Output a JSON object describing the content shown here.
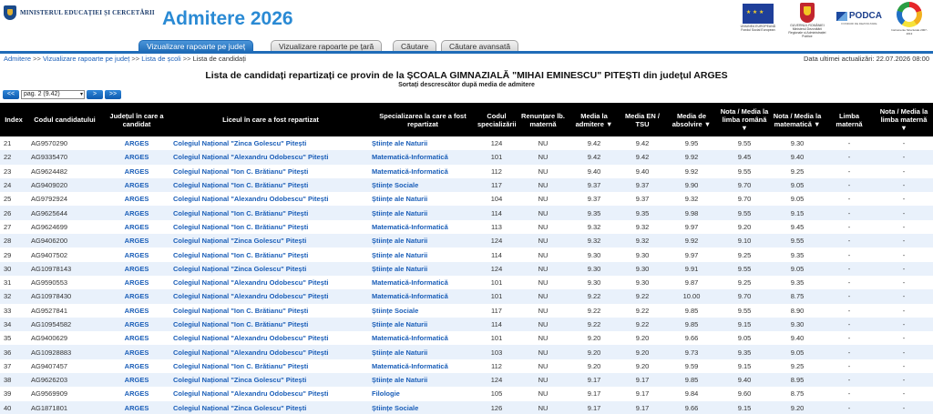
{
  "header": {
    "ministry": "MINISTERUL EDUCAȚIEI ȘI CERCETĂRII",
    "app_title": "Admitere 2026",
    "logos": [
      {
        "icon": "eu-flag-icon",
        "caption": "UNIUNEA EUROPEANĂ Fondul Social European"
      },
      {
        "icon": "romania-coat-of-arms-icon",
        "caption": "GUVERNUL ROMÂNIEI Ministerul Dezvoltării Regionale și Administrației Publice"
      },
      {
        "icon": "podca-logo-icon",
        "text": "PODCA",
        "caption": "FONDURI DE DEZVOLTARE"
      },
      {
        "icon": "instrumente-structurale-icon",
        "caption": "Instrumente Structurale 2007-2013"
      }
    ]
  },
  "tabs": [
    {
      "label": "Vizualizare rapoarte pe județ",
      "active": true
    },
    {
      "label": "Vizualizare rapoarte pe țară",
      "active": false
    },
    {
      "label": "Căutare",
      "active": false
    },
    {
      "label": "Căutare avansată",
      "active": false
    }
  ],
  "breadcrumb": {
    "items": [
      "Admitere",
      "Vizualizare rapoarte pe județ",
      "Lista de școli",
      "Lista de candidați"
    ],
    "separator": ">>"
  },
  "updated": "Data ultimei actualizări: 22.07.2026 08:00",
  "title": "Lista de candidați repartizați ce provin de la ȘCOALA GIMNAZIALĂ \"MIHAI EMINESCU\" PITEȘTI din județul ARGES",
  "subtitle": "Sortați descrescător după media de admitere",
  "pager": {
    "first": "<<",
    "prev": "<",
    "selected_page": "pag. 2 (9.42)",
    "next": ">",
    "last": ">>"
  },
  "columns": [
    "Index",
    "Codul candidatului",
    "Județul în care a candidat",
    "Liceul în care a fost repartizat",
    "Specializarea la care a fost repartizat",
    "Codul specializării",
    "Renunțare lb. maternă",
    "Media la admitere ▼",
    "Media EN / TSU",
    "Media de absolvire ▼",
    "Nota / Media la limba română ▼",
    "Nota / Media la matematică ▼",
    "Limba maternă",
    "Nota / Media la limba maternă ▼"
  ],
  "rows": [
    [
      "21",
      "AG9570290",
      "ARGES",
      "Colegiul Național \"Zinca Golescu\" Pitești",
      "Științe ale Naturii",
      "124",
      "NU",
      "9.42",
      "9.42",
      "9.95",
      "9.55",
      "9.30",
      "-",
      "-"
    ],
    [
      "22",
      "AG9335470",
      "ARGES",
      "Colegiul Național \"Alexandru Odobescu\" Pitești",
      "Matematică-Informatică",
      "101",
      "NU",
      "9.42",
      "9.42",
      "9.92",
      "9.45",
      "9.40",
      "-",
      "-"
    ],
    [
      "23",
      "AG9624482",
      "ARGES",
      "Colegiul Național \"Ion C. Brătianu\" Pitești",
      "Matematică-Informatică",
      "112",
      "NU",
      "9.40",
      "9.40",
      "9.92",
      "9.55",
      "9.25",
      "-",
      "-"
    ],
    [
      "24",
      "AG9409020",
      "ARGES",
      "Colegiul Național \"Ion C. Brătianu\" Pitești",
      "Științe Sociale",
      "117",
      "NU",
      "9.37",
      "9.37",
      "9.90",
      "9.70",
      "9.05",
      "-",
      "-"
    ],
    [
      "25",
      "AG9792924",
      "ARGES",
      "Colegiul Național \"Alexandru Odobescu\" Pitești",
      "Științe ale Naturii",
      "104",
      "NU",
      "9.37",
      "9.37",
      "9.32",
      "9.70",
      "9.05",
      "-",
      "-"
    ],
    [
      "26",
      "AG9625644",
      "ARGES",
      "Colegiul Național \"Ion C. Brătianu\" Pitești",
      "Științe ale Naturii",
      "114",
      "NU",
      "9.35",
      "9.35",
      "9.98",
      "9.55",
      "9.15",
      "-",
      "-"
    ],
    [
      "27",
      "AG9624699",
      "ARGES",
      "Colegiul Național \"Ion C. Brătianu\" Pitești",
      "Matematică-Informatică",
      "113",
      "NU",
      "9.32",
      "9.32",
      "9.97",
      "9.20",
      "9.45",
      "-",
      "-"
    ],
    [
      "28",
      "AG9406200",
      "ARGES",
      "Colegiul Național \"Zinca Golescu\" Pitești",
      "Științe ale Naturii",
      "124",
      "NU",
      "9.32",
      "9.32",
      "9.92",
      "9.10",
      "9.55",
      "-",
      "-"
    ],
    [
      "29",
      "AG9407502",
      "ARGES",
      "Colegiul Național \"Ion C. Brătianu\" Pitești",
      "Științe ale Naturii",
      "114",
      "NU",
      "9.30",
      "9.30",
      "9.97",
      "9.25",
      "9.35",
      "-",
      "-"
    ],
    [
      "30",
      "AG10978143",
      "ARGES",
      "Colegiul Național \"Zinca Golescu\" Pitești",
      "Științe ale Naturii",
      "124",
      "NU",
      "9.30",
      "9.30",
      "9.91",
      "9.55",
      "9.05",
      "-",
      "-"
    ],
    [
      "31",
      "AG9590553",
      "ARGES",
      "Colegiul Național \"Alexandru Odobescu\" Pitești",
      "Matematică-Informatică",
      "101",
      "NU",
      "9.30",
      "9.30",
      "9.87",
      "9.25",
      "9.35",
      "-",
      "-"
    ],
    [
      "32",
      "AG10978430",
      "ARGES",
      "Colegiul Național \"Alexandru Odobescu\" Pitești",
      "Matematică-Informatică",
      "101",
      "NU",
      "9.22",
      "9.22",
      "10.00",
      "9.70",
      "8.75",
      "-",
      "-"
    ],
    [
      "33",
      "AG9527841",
      "ARGES",
      "Colegiul Național \"Ion C. Brătianu\" Pitești",
      "Științe Sociale",
      "117",
      "NU",
      "9.22",
      "9.22",
      "9.85",
      "9.55",
      "8.90",
      "-",
      "-"
    ],
    [
      "34",
      "AG10954582",
      "ARGES",
      "Colegiul Național \"Ion C. Brătianu\" Pitești",
      "Științe ale Naturii",
      "114",
      "NU",
      "9.22",
      "9.22",
      "9.85",
      "9.15",
      "9.30",
      "-",
      "-"
    ],
    [
      "35",
      "AG9400629",
      "ARGES",
      "Colegiul Național \"Alexandru Odobescu\" Pitești",
      "Matematică-Informatică",
      "101",
      "NU",
      "9.20",
      "9.20",
      "9.66",
      "9.05",
      "9.40",
      "-",
      "-"
    ],
    [
      "36",
      "AG10928883",
      "ARGES",
      "Colegiul Național \"Alexandru Odobescu\" Pitești",
      "Științe ale Naturii",
      "103",
      "NU",
      "9.20",
      "9.20",
      "9.73",
      "9.35",
      "9.05",
      "-",
      "-"
    ],
    [
      "37",
      "AG9407457",
      "ARGES",
      "Colegiul Național \"Ion C. Brătianu\" Pitești",
      "Matematică-Informatică",
      "112",
      "NU",
      "9.20",
      "9.20",
      "9.59",
      "9.15",
      "9.25",
      "-",
      "-"
    ],
    [
      "38",
      "AG9626203",
      "ARGES",
      "Colegiul Național \"Zinca Golescu\" Pitești",
      "Științe ale Naturii",
      "124",
      "NU",
      "9.17",
      "9.17",
      "9.85",
      "9.40",
      "8.95",
      "-",
      "-"
    ],
    [
      "39",
      "AG9569909",
      "ARGES",
      "Colegiul Național \"Alexandru Odobescu\" Pitești",
      "Filologie",
      "105",
      "NU",
      "9.17",
      "9.17",
      "9.84",
      "9.60",
      "8.75",
      "-",
      "-"
    ],
    [
      "40",
      "AG1871801",
      "ARGES",
      "Colegiul Național \"Zinca Golescu\" Pitești",
      "Științe Sociale",
      "126",
      "NU",
      "9.17",
      "9.17",
      "9.66",
      "9.15",
      "9.20",
      "-",
      "-"
    ]
  ]
}
